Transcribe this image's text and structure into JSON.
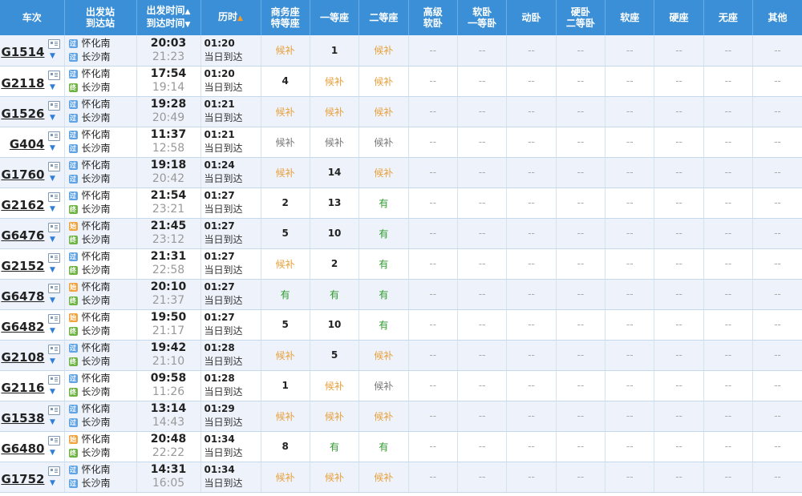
{
  "headers": {
    "train": "车次",
    "station": [
      "出发站",
      "到达站"
    ],
    "time": [
      "出发时间",
      "到达时间"
    ],
    "duration": "历时",
    "seats": [
      [
        "商务座",
        "特等座"
      ],
      [
        "一等座"
      ],
      [
        "二等座"
      ],
      [
        "高级",
        "软卧"
      ],
      [
        "软卧",
        "一等卧"
      ],
      [
        "动卧"
      ],
      [
        "硬卧",
        "二等卧"
      ],
      [
        "软座"
      ],
      [
        "硬座"
      ],
      [
        "无座"
      ],
      [
        "其他"
      ]
    ]
  },
  "sort_arrows": {
    "up": "▲",
    "down": "▼"
  },
  "colors": {
    "header_bg": "#3a8fd6",
    "alt_row": "#eef3fb",
    "bu": "#e8a03c",
    "you": "#2e9a2e"
  },
  "rows": [
    {
      "train": "G1514",
      "from_badge": "过",
      "from": "怀化南",
      "to_badge": "过",
      "to": "长沙南",
      "dep": "20:03",
      "arr": "21:23",
      "dur": "01:20",
      "arrive": "当日到达",
      "seats": [
        "候补",
        "1",
        "候补",
        "--",
        "--",
        "--",
        "--",
        "--",
        "--",
        "--",
        "--"
      ]
    },
    {
      "train": "G2118",
      "from_badge": "过",
      "from": "怀化南",
      "to_badge": "终",
      "to": "长沙南",
      "dep": "17:54",
      "arr": "19:14",
      "dur": "01:20",
      "arrive": "当日到达",
      "seats": [
        "4",
        "候补",
        "候补",
        "--",
        "--",
        "--",
        "--",
        "--",
        "--",
        "--",
        "--"
      ]
    },
    {
      "train": "G1526",
      "from_badge": "过",
      "from": "怀化南",
      "to_badge": "过",
      "to": "长沙南",
      "dep": "19:28",
      "arr": "20:49",
      "dur": "01:21",
      "arrive": "当日到达",
      "seats": [
        "候补",
        "候补",
        "候补",
        "--",
        "--",
        "--",
        "--",
        "--",
        "--",
        "--",
        "--"
      ]
    },
    {
      "train": "G404",
      "from_badge": "过",
      "from": "怀化南",
      "to_badge": "过",
      "to": "长沙南",
      "dep": "11:37",
      "arr": "12:58",
      "dur": "01:21",
      "arrive": "当日到达",
      "seats": [
        "候补",
        "候补",
        "候补",
        "--",
        "--",
        "--",
        "--",
        "--",
        "--",
        "--",
        "--"
      ]
    },
    {
      "train": "G1760",
      "from_badge": "过",
      "from": "怀化南",
      "to_badge": "过",
      "to": "长沙南",
      "dep": "19:18",
      "arr": "20:42",
      "dur": "01:24",
      "arrive": "当日到达",
      "seats": [
        "候补",
        "14",
        "候补",
        "--",
        "--",
        "--",
        "--",
        "--",
        "--",
        "--",
        "--"
      ]
    },
    {
      "train": "G2162",
      "from_badge": "过",
      "from": "怀化南",
      "to_badge": "终",
      "to": "长沙南",
      "dep": "21:54",
      "arr": "23:21",
      "dur": "01:27",
      "arrive": "当日到达",
      "seats": [
        "2",
        "13",
        "有",
        "--",
        "--",
        "--",
        "--",
        "--",
        "--",
        "--",
        "--"
      ]
    },
    {
      "train": "G6476",
      "from_badge": "始",
      "from": "怀化南",
      "to_badge": "终",
      "to": "长沙南",
      "dep": "21:45",
      "arr": "23:12",
      "dur": "01:27",
      "arrive": "当日到达",
      "seats": [
        "5",
        "10",
        "有",
        "--",
        "--",
        "--",
        "--",
        "--",
        "--",
        "--",
        "--"
      ]
    },
    {
      "train": "G2152",
      "from_badge": "过",
      "from": "怀化南",
      "to_badge": "终",
      "to": "长沙南",
      "dep": "21:31",
      "arr": "22:58",
      "dur": "01:27",
      "arrive": "当日到达",
      "seats": [
        "候补",
        "2",
        "有",
        "--",
        "--",
        "--",
        "--",
        "--",
        "--",
        "--",
        "--"
      ]
    },
    {
      "train": "G6478",
      "from_badge": "始",
      "from": "怀化南",
      "to_badge": "终",
      "to": "长沙南",
      "dep": "20:10",
      "arr": "21:37",
      "dur": "01:27",
      "arrive": "当日到达",
      "seats": [
        "有",
        "有",
        "有",
        "--",
        "--",
        "--",
        "--",
        "--",
        "--",
        "--",
        "--"
      ]
    },
    {
      "train": "G6482",
      "from_badge": "始",
      "from": "怀化南",
      "to_badge": "终",
      "to": "长沙南",
      "dep": "19:50",
      "arr": "21:17",
      "dur": "01:27",
      "arrive": "当日到达",
      "seats": [
        "5",
        "10",
        "有",
        "--",
        "--",
        "--",
        "--",
        "--",
        "--",
        "--",
        "--"
      ]
    },
    {
      "train": "G2108",
      "from_badge": "过",
      "from": "怀化南",
      "to_badge": "终",
      "to": "长沙南",
      "dep": "19:42",
      "arr": "21:10",
      "dur": "01:28",
      "arrive": "当日到达",
      "seats": [
        "候补",
        "5",
        "候补",
        "--",
        "--",
        "--",
        "--",
        "--",
        "--",
        "--",
        "--"
      ]
    },
    {
      "train": "G2116",
      "from_badge": "过",
      "from": "怀化南",
      "to_badge": "终",
      "to": "长沙南",
      "dep": "09:58",
      "arr": "11:26",
      "dur": "01:28",
      "arrive": "当日到达",
      "seats": [
        "1",
        "候补",
        "候补",
        "--",
        "--",
        "--",
        "--",
        "--",
        "--",
        "--",
        "--"
      ]
    },
    {
      "train": "G1538",
      "from_badge": "过",
      "from": "怀化南",
      "to_badge": "过",
      "to": "长沙南",
      "dep": "13:14",
      "arr": "14:43",
      "dur": "01:29",
      "arrive": "当日到达",
      "seats": [
        "候补",
        "候补",
        "候补",
        "--",
        "--",
        "--",
        "--",
        "--",
        "--",
        "--",
        "--"
      ]
    },
    {
      "train": "G6480",
      "from_badge": "始",
      "from": "怀化南",
      "to_badge": "终",
      "to": "长沙南",
      "dep": "20:48",
      "arr": "22:22",
      "dur": "01:34",
      "arrive": "当日到达",
      "seats": [
        "8",
        "有",
        "有",
        "--",
        "--",
        "--",
        "--",
        "--",
        "--",
        "--",
        "--"
      ]
    },
    {
      "train": "G1752",
      "from_badge": "过",
      "from": "怀化南",
      "to_badge": "过",
      "to": "长沙南",
      "dep": "14:31",
      "arr": "16:05",
      "dur": "01:34",
      "arrive": "当日到达",
      "seats": [
        "候补",
        "候补",
        "候补",
        "--",
        "--",
        "--",
        "--",
        "--",
        "--",
        "--",
        "--"
      ]
    }
  ]
}
